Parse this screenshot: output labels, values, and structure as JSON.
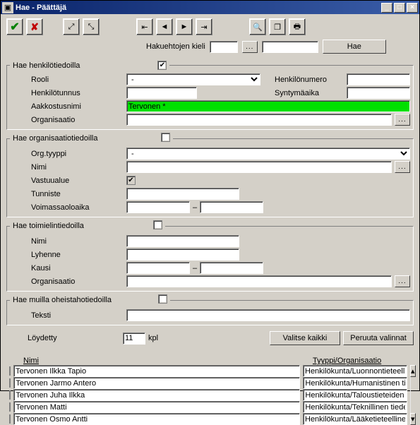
{
  "window": {
    "title": "Hae - Päättäjä"
  },
  "toolbar": {
    "confirm": "✓",
    "cancel": "✕"
  },
  "searchlang": {
    "label": "Hakuehtojen kieli",
    "btn_dots": "...",
    "hae": "Hae"
  },
  "fs1": {
    "legend": "Hae henkilötiedoilla",
    "rooli": "Rooli",
    "rooli_val": "-",
    "henkilonum": "Henkilönumero",
    "henkilotunnus": "Henkilötunnus",
    "syntymaaika": "Syntymäaika",
    "aakkostusnimi": "Aakkostusnimi",
    "aakkostus_val": "Tervonen *",
    "organisaatio": "Organisaatio"
  },
  "fs2": {
    "legend": "Hae organisaatiotiedoilla",
    "orgtyyppi": "Org.tyyppi",
    "orgtyyppi_val": "-",
    "nimi": "Nimi",
    "vastuualue": "Vastuualue",
    "tunniste": "Tunniste",
    "voimassa": "Voimassaoloaika",
    "dash": "–"
  },
  "fs3": {
    "legend": "Hae toimielintiedoilla",
    "nimi": "Nimi",
    "lyhenne": "Lyhenne",
    "kausi": "Kausi",
    "dash": "–",
    "organisaatio": "Organisaatio"
  },
  "fs4": {
    "legend": "Hae muilla oheistahotiedoilla",
    "teksti": "Teksti"
  },
  "found": {
    "label": "Löydetty",
    "count": "11",
    "unit": "kpl",
    "select_all": "Valitse kaikki",
    "cancel_sel": "Peruuta valinnat"
  },
  "results": {
    "col1": "Nimi",
    "col2": "Tyyppi/Organisaatio",
    "rows": [
      {
        "nimi": "Tervonen Ilkka Tapio",
        "tyyppi": "Henkilökunta/Luonnontieteelli"
      },
      {
        "nimi": "Tervonen Jarmo Antero",
        "tyyppi": "Henkilökunta/Humanistinen tie"
      },
      {
        "nimi": "Tervonen Juha Ilkka",
        "tyyppi": "Henkilökunta/Taloustieteiden"
      },
      {
        "nimi": "Tervonen Matti",
        "tyyppi": "Henkilökunta/Teknillinen tiede"
      },
      {
        "nimi": "Tervonen Osmo Antti",
        "tyyppi": "Henkilökunta/Lääketieteelline"
      }
    ]
  }
}
